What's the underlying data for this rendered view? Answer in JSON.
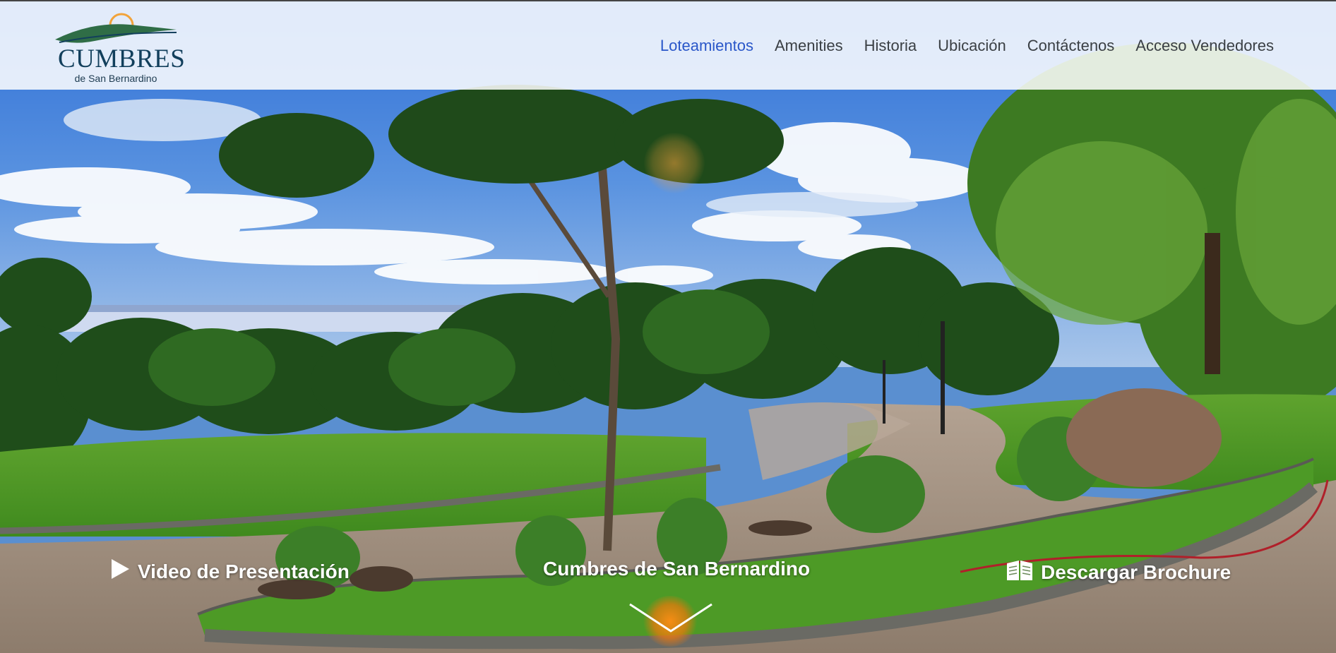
{
  "logo": {
    "title": "CUMBRES",
    "subtitle": "de San Bernardino"
  },
  "nav": {
    "items": [
      {
        "label": "Loteamientos",
        "active": true
      },
      {
        "label": "Amenities",
        "active": false
      },
      {
        "label": "Historia",
        "active": false
      },
      {
        "label": "Ubicación",
        "active": false
      },
      {
        "label": "Contáctenos",
        "active": false
      },
      {
        "label": "Acceso Vendedores",
        "active": false
      }
    ]
  },
  "hero": {
    "video_label": "Video de Presentación",
    "center_label": "Cumbres de San Bernardino",
    "brochure_label": "Descargar Brochure"
  },
  "icons": {
    "video": "play-icon",
    "brochure": "brochure-icon",
    "scroll": "chevron-down-icon"
  },
  "colors": {
    "nav_active": "#2a57c9",
    "nav_default": "#3a3f44",
    "logo_text": "#123f5c",
    "logo_sun": "#f2a33a",
    "scroll_glow": "#f07a10"
  }
}
